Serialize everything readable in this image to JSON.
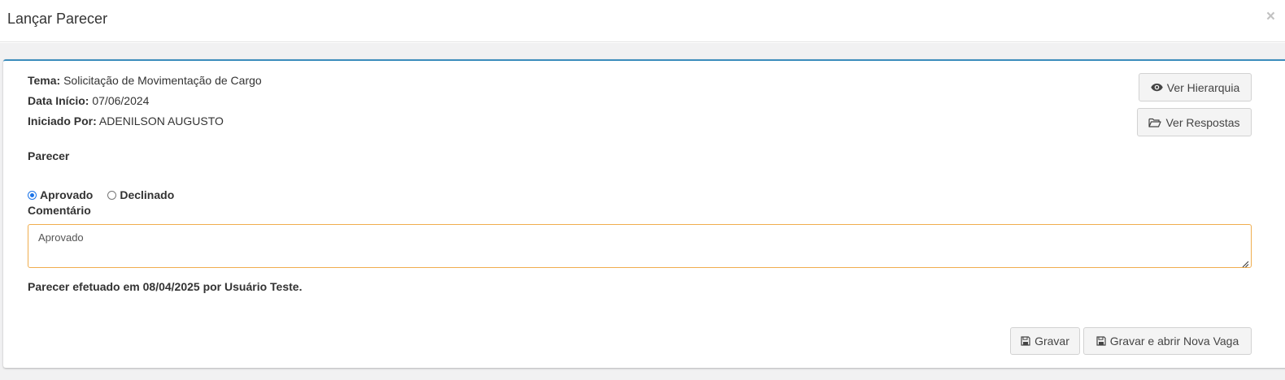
{
  "modal": {
    "title": "Lançar Parecer",
    "close_symbol": "×"
  },
  "info": {
    "tema_label": "Tema:",
    "tema_value": "Solicitação de Movimentação de Cargo",
    "data_inicio_label": "Data Início:",
    "data_inicio_value": "07/06/2024",
    "iniciado_por_label": "Iniciado Por:",
    "iniciado_por_value": "ADENILSON AUGUSTO"
  },
  "actions_top": {
    "ver_hierarquia": {
      "label": "Ver Hierarquia",
      "icon": "eye-icon"
    },
    "ver_respostas": {
      "label": "Ver Respostas",
      "icon": "folder-open-icon"
    }
  },
  "parecer": {
    "label": "Parecer",
    "options": [
      {
        "label": "Aprovado",
        "checked": true
      },
      {
        "label": "Declinado",
        "checked": false
      }
    ]
  },
  "comentario": {
    "label": "Comentário",
    "value": "Aprovado"
  },
  "status": {
    "text": "Parecer efetuado em 08/04/2025 por Usuário Teste."
  },
  "actions_bottom": {
    "gravar": {
      "label": "Gravar",
      "icon": "floppy-disk-icon"
    },
    "gravar_nova_vaga": {
      "label": "Gravar e abrir Nova Vaga",
      "icon": "floppy-disk-icon"
    }
  },
  "colors": {
    "panel_accent": "#3c8dbc",
    "textarea_border": "#f0ad4e",
    "radio_checked": "#1a73e8"
  }
}
